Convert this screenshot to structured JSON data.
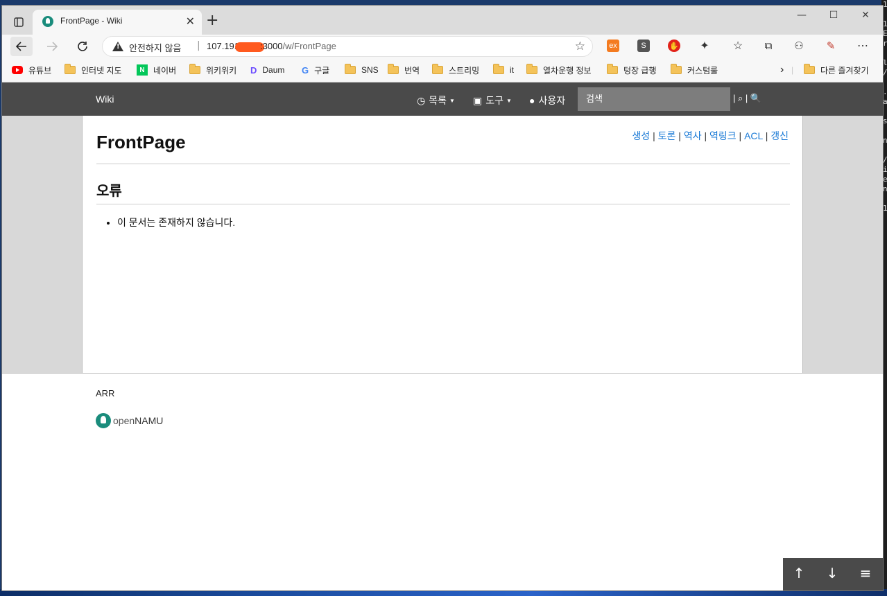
{
  "desktop": {
    "side_text": "1\n\n1\nE\nr\n\nl\n/\n\n.\na\n\ns\n\nn\n\n/\ni\ne\nn\n\n1"
  },
  "browser": {
    "tab": {
      "title": "FrontPage - Wiki"
    },
    "window_controls": {
      "minimize": "—",
      "maximize": "☐",
      "close": "✕"
    },
    "address": {
      "security_label": "안전하지 않음",
      "url_host": "107.191",
      "url_rest": ":3000",
      "url_path": "/w/FrontPage"
    },
    "extensions": [
      {
        "name": "ex",
        "label": "ex",
        "bg": "#f47b20"
      },
      {
        "name": "s",
        "label": "S",
        "bg": "#555555"
      },
      {
        "name": "adblock",
        "label": "✋",
        "bg": "#e2231a"
      }
    ],
    "bookmarks": [
      {
        "label": "유튜브",
        "icon": "youtube-icon"
      },
      {
        "label": "인터넷 지도",
        "icon": "folder-icon"
      },
      {
        "label": "네이버",
        "icon": "naver-icon"
      },
      {
        "label": "위키위키",
        "icon": "folder-icon"
      },
      {
        "label": "Daum",
        "icon": "daum-icon"
      },
      {
        "label": "구글",
        "icon": "google-icon"
      },
      {
        "label": "SNS",
        "icon": "folder-icon"
      },
      {
        "label": "번역",
        "icon": "folder-icon"
      },
      {
        "label": "스트리밍",
        "icon": "folder-icon"
      },
      {
        "label": "it",
        "icon": "folder-icon"
      },
      {
        "label": "열차운행 정보",
        "icon": "folder-icon"
      },
      {
        "label": "텅장 급행",
        "icon": "folder-icon"
      },
      {
        "label": "커스텀룰",
        "icon": "folder-icon"
      }
    ],
    "other_bookmarks": "다른 즐겨찾기"
  },
  "wiki": {
    "brand": "Wiki",
    "nav": {
      "list": "목록",
      "tools": "도구",
      "user": "사용자"
    },
    "search": {
      "placeholder": "검색"
    },
    "search_tools": "| ⌕ | 🔍",
    "page": {
      "title": "FrontPage",
      "tools": [
        "생성",
        "토론",
        "역사",
        "역링크",
        "ACL",
        "갱신"
      ],
      "section_title": "오류",
      "error_message": "이 문서는 존재하지 않습니다."
    },
    "footer": {
      "license": "ARR",
      "logo_text_a": "open",
      "logo_text_b": "NAMU"
    },
    "float_nav": {
      "up": "↑",
      "down": "↓",
      "toc": "≡"
    }
  }
}
